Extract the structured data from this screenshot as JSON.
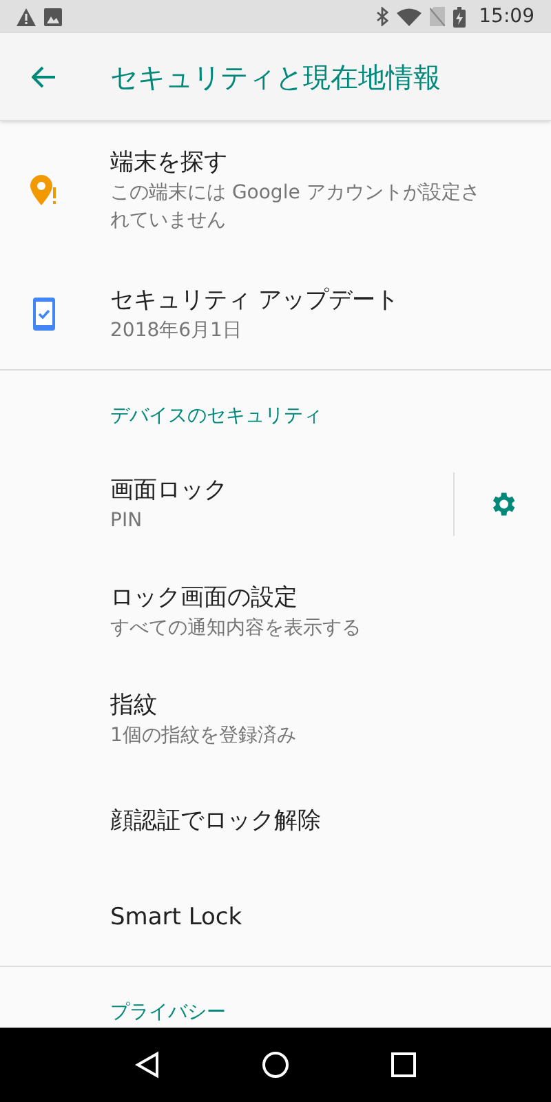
{
  "status_bar": {
    "time": "15:09"
  },
  "app_bar": {
    "title": "セキュリティと現在地情報"
  },
  "top_items": [
    {
      "kind": "warning",
      "title": "端末を探す",
      "subtitle": "この端末には Google アカウントが設定されていません"
    },
    {
      "kind": "update",
      "title": "セキュリティ アップデート",
      "subtitle": "2018年6月1日"
    }
  ],
  "sections": [
    {
      "header": "デバイスのセキュリティ",
      "items": [
        {
          "kind": "gear",
          "title": "画面ロック",
          "subtitle": "PIN"
        },
        {
          "kind": "plain",
          "title": "ロック画面の設定",
          "subtitle": "すべての通知内容を表示する"
        },
        {
          "kind": "plain",
          "title": "指紋",
          "subtitle": "1個の指紋を登録済み"
        },
        {
          "kind": "plain",
          "title": "顔認証でロック解除"
        },
        {
          "kind": "plain",
          "title": "Smart Lock"
        }
      ]
    },
    {
      "header": "プライバシー"
    }
  ]
}
